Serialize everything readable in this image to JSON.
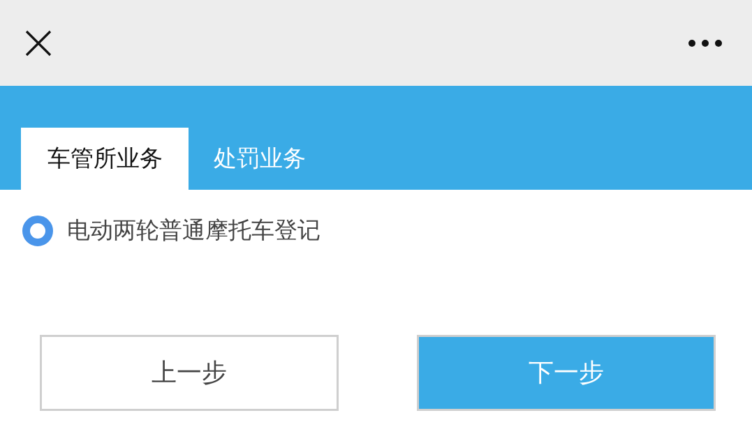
{
  "tabs": [
    {
      "label": "车管所业务",
      "selected": true
    },
    {
      "label": "处罚业务",
      "selected": false
    }
  ],
  "options": [
    {
      "label": "电动两轮普通摩托车登记",
      "selected": true
    }
  ],
  "buttons": [
    {
      "label": "上一步",
      "kind": "secondary"
    },
    {
      "label": "下一步",
      "kind": "primary"
    }
  ]
}
